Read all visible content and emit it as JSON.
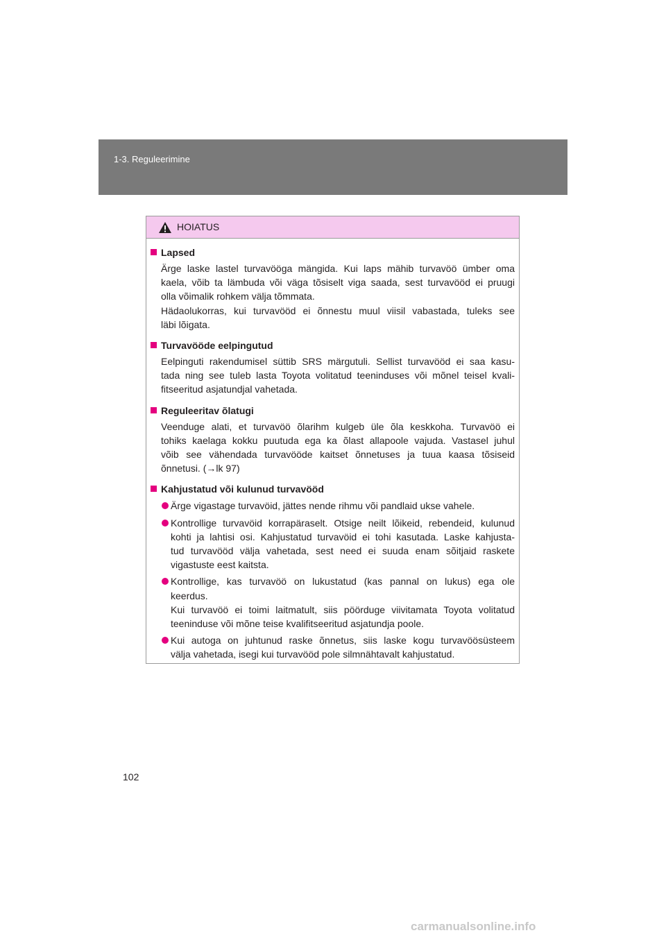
{
  "header": {
    "section_label": "1-3. Reguleerimine"
  },
  "warning": {
    "title": "HOIATUS",
    "sections": [
      {
        "heading": "Lapsed",
        "p1_lines": [
          "Ärge laske lastel turvavööga mängida. Kui laps mähib turvavöö ümber oma",
          "kaela, võib ta lämbuda või väga tõsiselt viga saada, sest turvavööd ei pruugi",
          "olla võimalik rohkem välja tõmmata."
        ],
        "p2_lines": [
          "Hädaolukorras, kui turvavööd ei õnnestu muul viisil vabastada, tuleks see",
          "läbi lõigata."
        ]
      },
      {
        "heading": "Turvavööde eelpingutud",
        "p1_lines": [
          "Eelpinguti rakendumisel süttib SRS märgutuli. Sellist turvavööd ei saa kasu-",
          "tada ning see tuleb lasta Toyota volitatud teeninduses või mõnel teisel kvali-",
          "fitseeritud asjatundjal vahetada."
        ]
      },
      {
        "heading": "Reguleeritav õlatugi",
        "p1_lines": [
          "Veenduge alati, et turvavöö õlarihm kulgeb üle õla keskkoha. Turvavöö ei",
          "tohiks kaelaga kokku puutuda ega ka õlast allapoole vajuda. Vastasel juhul",
          "võib see vähendada turvavööde kaitset õnnetuses ja tuua kaasa tõsiseid",
          "õnnetusi. (→lk 97)"
        ]
      },
      {
        "heading": "Kahjustatud või kulunud turvavööd",
        "bullets": [
          {
            "lines": [
              "Ärge vigastage turvavöid, jättes nende rihmu või pandlaid ukse vahele."
            ]
          },
          {
            "lines": [
              "Kontrollige turvavöid korrapäraselt. Otsige neilt lõikeid, rebendeid, kulunud",
              "kohti ja lahtisi osi. Kahjustatud turvavöid ei tohi kasutada. Laske kahjusta-",
              "tud turvavööd välja vahetada, sest need ei suuda enam sõitjaid raskete",
              "vigastuste eest kaitsta."
            ]
          },
          {
            "lines": [
              "Kontrollige, kas turvavöö on lukustatud (kas pannal on lukus) ega ole",
              "keerdus."
            ],
            "lines2": [
              "Kui turvavöö ei toimi laitmatult, siis pöörduge viivitamata Toyota volitatud",
              "teeninduse või mõne teise kvalifitseeritud asjatundja poole."
            ]
          },
          {
            "lines": [
              "Kui autoga on juhtunud raske õnnetus, siis laske kogu turvavöösüsteem",
              "välja vahetada, isegi kui turvavööd pole silmnähtavalt kahjustatud."
            ]
          }
        ]
      }
    ]
  },
  "footer": {
    "page_number": "102",
    "watermark": "carmanualsonline.info"
  },
  "colors": {
    "header_band": "#7a7a7a",
    "warning_header_bg": "#f5c9ee",
    "bullet_accent": "#e4007f"
  },
  "icons": {
    "warning": "warning-triangle-icon"
  }
}
